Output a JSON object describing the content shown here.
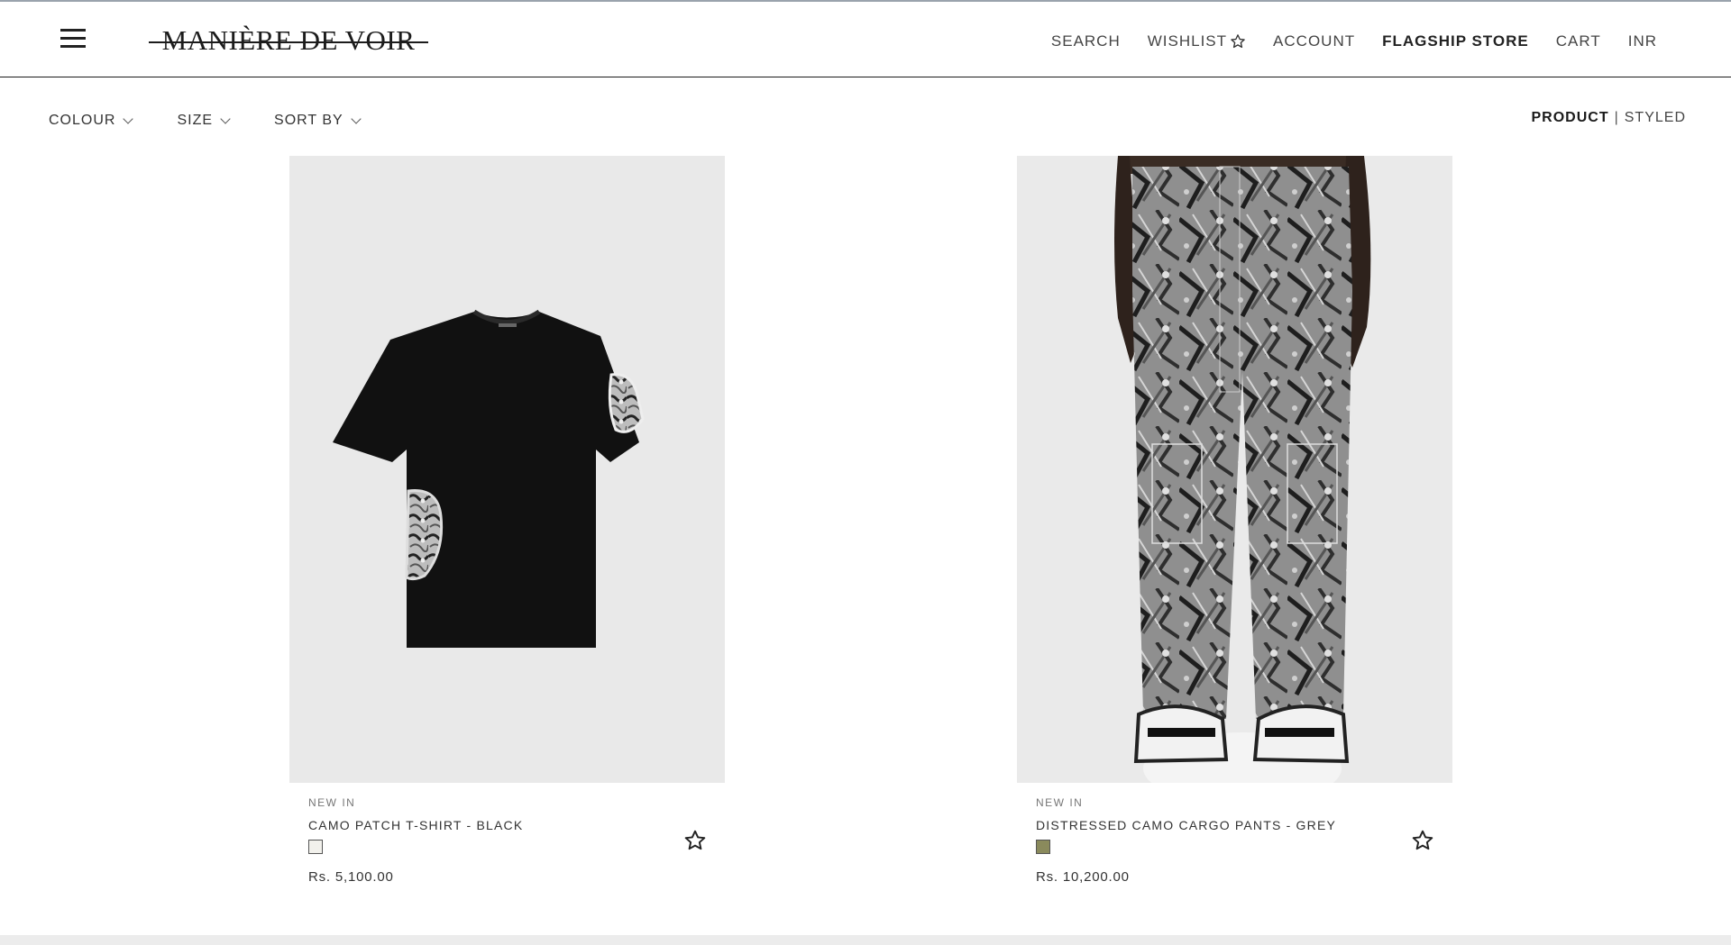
{
  "brand": {
    "logo_text": "MANIÈRE DE VOIR"
  },
  "nav": {
    "search": "SEARCH",
    "wishlist": "WISHLIST",
    "account": "ACCOUNT",
    "flagship": "FLAGSHIP STORE",
    "cart": "CART",
    "currency": "INR"
  },
  "filters": {
    "colour": "COLOUR",
    "size": "SIZE",
    "sort": "SORT BY"
  },
  "view_mode": {
    "product": "PRODUCT",
    "separator": "|",
    "styled": "STYLED"
  },
  "products": [
    {
      "badge": "NEW IN",
      "name": "CAMO PATCH T-SHIRT - BLACK",
      "swatch_color": "#f2f1ec",
      "price": "Rs. 5,100.00"
    },
    {
      "badge": "NEW IN",
      "name": "DISTRESSED CAMO CARGO PANTS - GREY",
      "swatch_color": "#8a8a5c",
      "price": "Rs. 10,200.00"
    }
  ],
  "colors": {
    "text": "#2b2b2b",
    "image_bg": "#e9e9e9",
    "header_border": "#1a1a1a"
  }
}
